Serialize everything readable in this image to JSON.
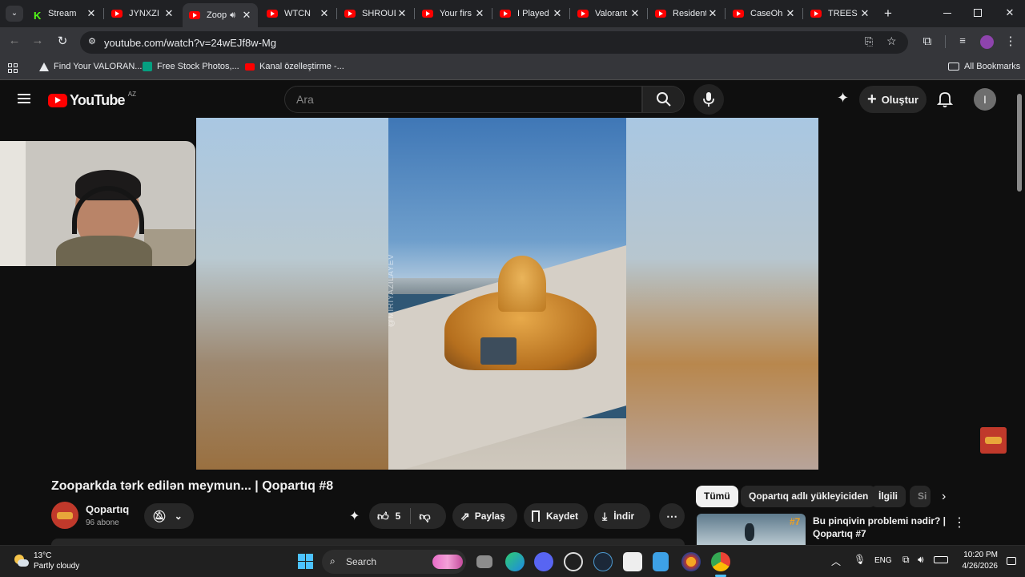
{
  "tabs": [
    {
      "title": "Stream",
      "icon": "kick-icon"
    },
    {
      "title": "JYNXZI",
      "icon": "youtube-icon"
    },
    {
      "title": "Zoop",
      "icon": "youtube-icon"
    },
    {
      "title": "WTCN",
      "icon": "youtube-icon"
    },
    {
      "title": "SHROUD",
      "icon": "youtube-icon"
    },
    {
      "title": "Your firs",
      "icon": "youtube-icon"
    },
    {
      "title": "I Played",
      "icon": "youtube-icon"
    },
    {
      "title": "Valorant",
      "icon": "youtube-icon"
    },
    {
      "title": "Resident",
      "icon": "youtube-icon"
    },
    {
      "title": "CaseOh",
      "icon": "youtube-icon"
    },
    {
      "title": "TREES H",
      "icon": "youtube-icon"
    }
  ],
  "address": {
    "url": "youtube.com/watch?v=24wEJf8w-Mg"
  },
  "bookmarks": {
    "items": [
      "Find Your VALORAN...",
      "Free Stock Photos,...",
      "Kanal özelleştirme -..."
    ],
    "all_label": "All Bookmarks"
  },
  "youtube": {
    "logo_text": "YouTube",
    "region": "AZ",
    "search_placeholder": "Ara",
    "create_label": "Oluştur",
    "avatar_letter": "I"
  },
  "video": {
    "watermark": "@MIRIYAZILAYEV",
    "title": "Zooparkda tərk edilən meymun... | Qopartıq #8",
    "channel": "Qopartıq",
    "subscribers": "96 abone",
    "like_count": "5",
    "share_label": "Paylaş",
    "save_label": "Kaydet",
    "download_label": "İndir"
  },
  "chips": [
    "Tümü",
    "Qopartıq adlı yükleyiciden",
    "İlgili",
    "Si"
  ],
  "recommended": {
    "title_line1": "Bu pinqivin problemi nədir? |",
    "title_line2": "Qopartıq #7",
    "badge": "#7"
  },
  "taskbar": {
    "weather_temp": "13°C",
    "weather_desc": "Partly cloudy",
    "search_label": "Search",
    "lang": "ENG",
    "time": "10:20 PM",
    "date": "4/26/2026"
  },
  "colors": {
    "yt_red": "#ff0000",
    "accent_orange": "#d28a2a"
  }
}
